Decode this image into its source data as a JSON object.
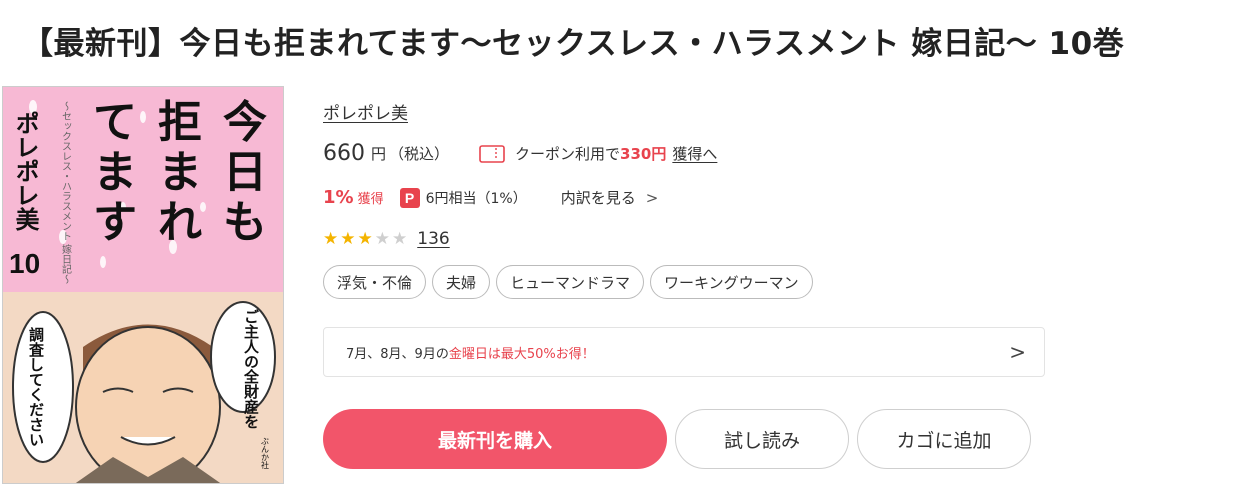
{
  "title": "【最新刊】今日も拒まれてます〜セックスレス・ハラスメント 嫁日記〜 10巻",
  "cover": {
    "title_lines": [
      "今",
      "日",
      "も",
      "拒",
      "ま",
      "れ",
      "て",
      "ま",
      "す"
    ],
    "subtitle": "〜セックスレス・ハラスメント 嫁日記〜",
    "author": "ポレポレ美",
    "volume": "10",
    "bubble_left": "調査してください",
    "bubble_right": "ご主人の全財産を",
    "publisher": "ぶんか社",
    "bg_color": "#f7b9d4"
  },
  "author": "ポレポレ美",
  "price": {
    "amount": "660",
    "unit": "円",
    "tax": "（税込）"
  },
  "coupon": {
    "prefix": "クーポン利用で",
    "amount": "330円",
    "link": "獲得へ"
  },
  "points": {
    "rate": "1%",
    "unit": "獲得",
    "pay_icon": "P",
    "pay_text": "6円相当（1%）",
    "breakdown": "内訳を見る",
    "breakdown_chevron": ">"
  },
  "rating": {
    "stars": 3,
    "max": 5,
    "count": "136"
  },
  "tags": [
    "浮気・不倫",
    "夫婦",
    "ヒューマンドラマ",
    "ワーキングウーマン"
  ],
  "campaign": {
    "text_before": "7月、8月、9月の",
    "text_highlight": "金曜日は最大50%お得！",
    "arrow": ">"
  },
  "buttons": {
    "buy": "最新刊を購入",
    "trial": "試し読み",
    "cart": "カゴに追加"
  },
  "colors": {
    "accent": "#e8434d",
    "button": "#f2556a",
    "star": "#f4b400"
  }
}
